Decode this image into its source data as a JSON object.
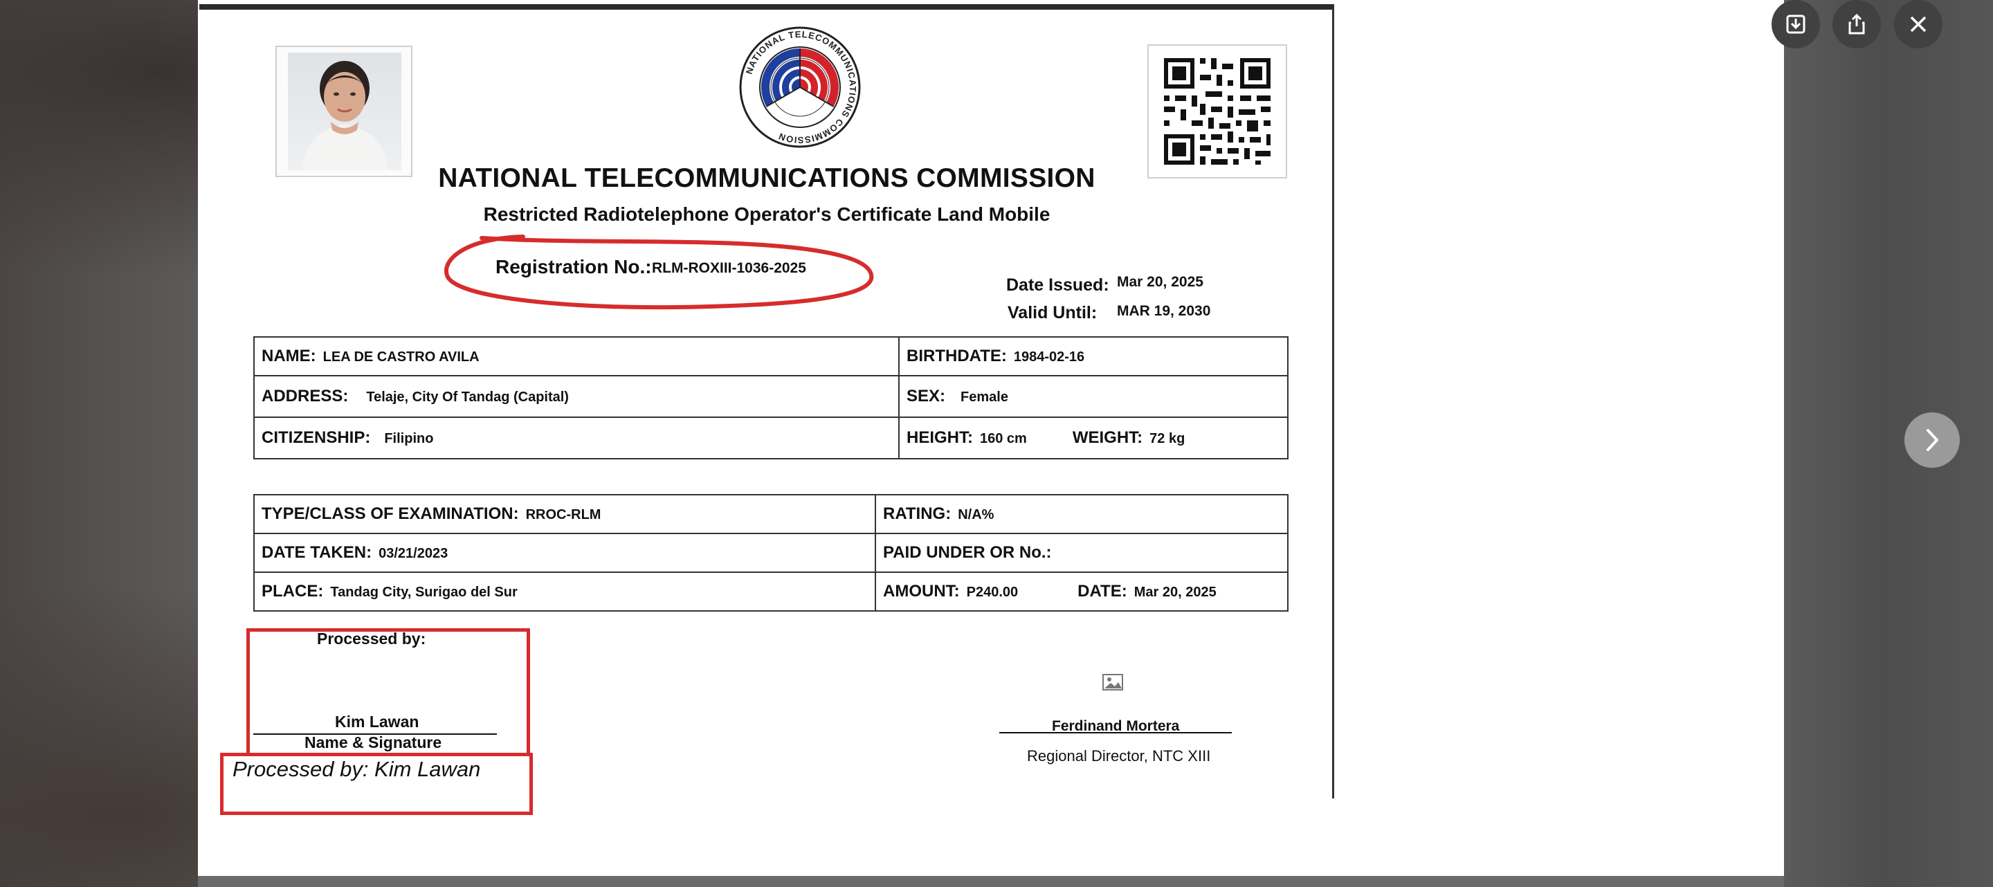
{
  "viewer": {
    "controls": {
      "save_icon": "save-icon",
      "share_icon": "share-icon",
      "close_icon": "close-icon",
      "next_icon": "chevron-right-icon"
    }
  },
  "document": {
    "seal_text": "NATIONAL TELECOMMUNICATIONS COMMISSION",
    "agency": "NATIONAL TELECOMMUNICATIONS COMMISSION",
    "certificate_title": "Restricted Radiotelephone Operator's Certificate Land Mobile",
    "registration": {
      "label": "Registration No.:",
      "value": "RLM-ROXIII-1036-2025"
    },
    "date_issued": {
      "label": "Date Issued:",
      "value": "Mar 20, 2025"
    },
    "valid_until": {
      "label": "Valid Until:",
      "value": "MAR 19, 2030"
    },
    "personal": {
      "name_label": "NAME:",
      "name": "LEA DE CASTRO AVILA",
      "birthdate_label": "BIRTHDATE:",
      "birthdate": "1984-02-16",
      "address_label": "ADDRESS:",
      "address": "Telaje, City Of Tandag (Capital)",
      "sex_label": "SEX:",
      "sex": "Female",
      "citizenship_label": "CITIZENSHIP:",
      "citizenship": "Filipino",
      "height_label": "HEIGHT:",
      "height": "160 cm",
      "weight_label": "WEIGHT:",
      "weight": "72 kg"
    },
    "exam": {
      "type_label": "TYPE/CLASS OF EXAMINATION:",
      "type": "RROC-RLM",
      "rating_label": "RATING:",
      "rating": "N/A%",
      "date_taken_label": "DATE TAKEN:",
      "date_taken": "03/21/2023",
      "or_label": "PAID UNDER OR No.:",
      "or": "",
      "place_label": "PLACE:",
      "place": "Tandag City, Surigao del Sur",
      "amount_label": "AMOUNT:",
      "amount": "P240.00",
      "date_label": "DATE:",
      "date": "Mar 20, 2025"
    },
    "processed": {
      "label": "Processed by:",
      "name": "Kim  Lawan",
      "caption": "Name & Signature",
      "annotation": "Processed by: Kim  Lawan"
    },
    "director": {
      "name": "Ferdinand  Mortera",
      "title": "Regional Director, NTC XIII",
      "image_placeholder_icon": "image-icon"
    }
  },
  "colors": {
    "annotation_red": "#d62c2c",
    "seal_blue": "#1f3f9e",
    "seal_red": "#d2232a"
  }
}
